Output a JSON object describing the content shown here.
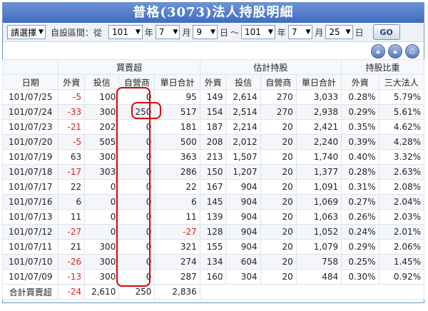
{
  "title": "普格(3073)法人持股明細",
  "filter": {
    "select_label": "請選擇",
    "range_label": "自設區間：從",
    "from": {
      "year": "101",
      "month": "7",
      "day": "9"
    },
    "to": {
      "year": "101",
      "month": "7",
      "day": "25"
    },
    "unit_year": "年",
    "unit_month": "月",
    "unit_day": "日",
    "tilde": "～",
    "go_label": "GO"
  },
  "icons": [
    "lock-icon",
    "lock-icon",
    "print-icon"
  ],
  "table": {
    "group_headers": {
      "buy_sell": "買賣超",
      "est_holding": "估計持股",
      "ratio": "持股比重"
    },
    "columns": [
      "日期",
      "外資",
      "投信",
      "自營商",
      "單日合計",
      "外資",
      "投信",
      "自營商",
      "單日合計",
      "外資",
      "三大法人"
    ],
    "rows": [
      [
        "101/07/25",
        "-5",
        "100",
        "0",
        "95",
        "149",
        "2,614",
        "270",
        "3,033",
        "0.28%",
        "5.79%"
      ],
      [
        "101/07/24",
        "-33",
        "300",
        "250",
        "517",
        "154",
        "2,514",
        "270",
        "2,938",
        "0.29%",
        "5.61%"
      ],
      [
        "101/07/23",
        "-21",
        "202",
        "0",
        "181",
        "187",
        "2,214",
        "20",
        "2,421",
        "0.35%",
        "4.62%"
      ],
      [
        "101/07/20",
        "-5",
        "505",
        "0",
        "500",
        "208",
        "2,012",
        "20",
        "2,240",
        "0.39%",
        "4.28%"
      ],
      [
        "101/07/19",
        "63",
        "300",
        "0",
        "363",
        "213",
        "1,507",
        "20",
        "1,740",
        "0.40%",
        "3.32%"
      ],
      [
        "101/07/18",
        "-17",
        "303",
        "0",
        "286",
        "150",
        "1,207",
        "20",
        "1,377",
        "0.28%",
        "2.63%"
      ],
      [
        "101/07/17",
        "22",
        "0",
        "0",
        "22",
        "167",
        "904",
        "20",
        "1,091",
        "0.31%",
        "2.08%"
      ],
      [
        "101/07/16",
        "6",
        "0",
        "0",
        "6",
        "145",
        "904",
        "20",
        "1,069",
        "0.27%",
        "2.04%"
      ],
      [
        "101/07/13",
        "11",
        "0",
        "0",
        "11",
        "139",
        "904",
        "20",
        "1,063",
        "0.26%",
        "2.03%"
      ],
      [
        "101/07/12",
        "-27",
        "0",
        "0",
        "-27",
        "128",
        "904",
        "20",
        "1,052",
        "0.24%",
        "2.01%"
      ],
      [
        "101/07/11",
        "21",
        "300",
        "0",
        "321",
        "155",
        "904",
        "20",
        "1,079",
        "0.29%",
        "2.06%"
      ],
      [
        "101/07/10",
        "-26",
        "300",
        "0",
        "274",
        "134",
        "604",
        "20",
        "758",
        "0.25%",
        "1.45%"
      ],
      [
        "101/07/09",
        "-13",
        "300",
        "0",
        "287",
        "160",
        "304",
        "20",
        "484",
        "0.30%",
        "0.92%"
      ]
    ],
    "total": {
      "label": "合計買賣超",
      "values": [
        "-24",
        "2,610",
        "250",
        "2,836"
      ]
    }
  },
  "colors": {
    "title_bg": "#4a76c4",
    "negative": "#e02020",
    "highlight": "#e00000"
  }
}
